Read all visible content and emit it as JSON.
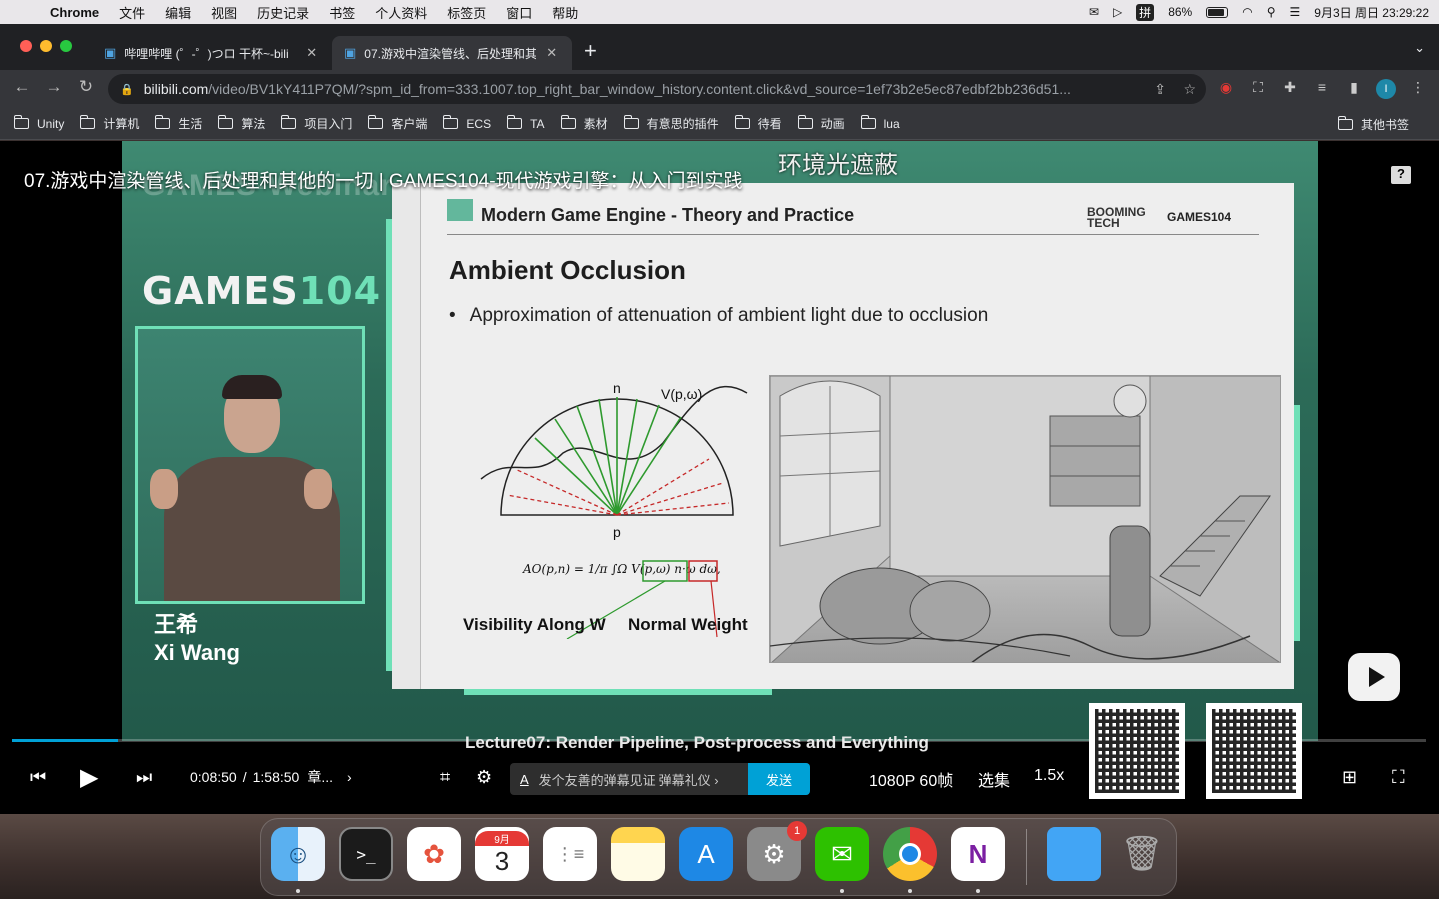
{
  "menubar": {
    "app_name": "Chrome",
    "items": [
      "文件",
      "编辑",
      "视图",
      "历史记录",
      "书签",
      "个人资料",
      "标签页",
      "窗口",
      "帮助"
    ],
    "battery": "86%",
    "datetime": "9月3日 周日 23:29:22",
    "input_method": "拼"
  },
  "browser": {
    "tabs": [
      {
        "title": "哔哩哔哩 (゜-゜)つロ 干杯~-bili",
        "active": false
      },
      {
        "title": "07.游戏中渲染管线、后处理和其",
        "active": true
      }
    ],
    "url_host": "bilibili.com",
    "url_path": "/video/BV1kY411P7QM/?spm_id_from=333.1007.top_right_bar_window_history.content.click&vd_source=1ef73b2e5ec87edbf2bb236d51...",
    "profile_initial": "I",
    "bookmarks": [
      "Unity",
      "计算机",
      "生活",
      "算法",
      "项目入门",
      "客户端",
      "ECS",
      "TA",
      "素材",
      "有意思的插件",
      "待看",
      "动画",
      "lua"
    ],
    "other_bookmarks": "其他书签"
  },
  "video": {
    "title": "07.游戏中渲染管线、后处理和其他的一切 | GAMES104-现代游戏引擎：从入门到实践",
    "overlay_text": "环境光遮蔽",
    "watermark": "GAMES-Webinar",
    "logo_prefix": "GAMES",
    "logo_suffix": "104",
    "speaker_cn": "王希",
    "speaker_en": "Xi Wang",
    "slide": {
      "header": "Modern Game Engine - Theory and Practice",
      "brand1_line1": "BOOMING",
      "brand1_line2": "TECH",
      "brand2": "GAMES104",
      "title": "Ambient Occlusion",
      "bullet": "Approximation of attenuation of ambient light due to occlusion",
      "diagram_n": "n",
      "diagram_v": "V(p,ω)",
      "diagram_p": "p",
      "formula": "AO(p,n) = 1/π ∫Ω V(p,ω) n·ω dω,",
      "label_visibility": "Visibility Along W",
      "label_normal": "Normal Weight"
    },
    "caption": "Lecture07: Render Pipeline, Post-process and Everything",
    "progress": 0.075,
    "current_time": "0:08:50",
    "separator": "/",
    "total_time": "1:58:50",
    "chapter": "章...",
    "danmu_placeholder": "发个友善的弹幕见证当下",
    "danmu_etiquette": "弹幕礼仪 ›",
    "send_label": "发送",
    "quality": "1080P 60帧",
    "episodes": "选集",
    "speed": "1.5x"
  },
  "dock": {
    "apps": [
      "Finder",
      "Terminal",
      "Photos",
      "Calendar",
      "Reminders",
      "Notes",
      "App Store",
      "System Preferences",
      "WeChat",
      "Chrome",
      "OneNote",
      "Folder",
      "Trash"
    ],
    "calendar_month": "9月",
    "calendar_day": "3",
    "settings_badge": "1",
    "terminal_prompt": ">_"
  },
  "colors": {
    "bilibili_blue": "#00a1d6",
    "games_green": "#6fe0b7",
    "chrome_dark": "#202124"
  }
}
